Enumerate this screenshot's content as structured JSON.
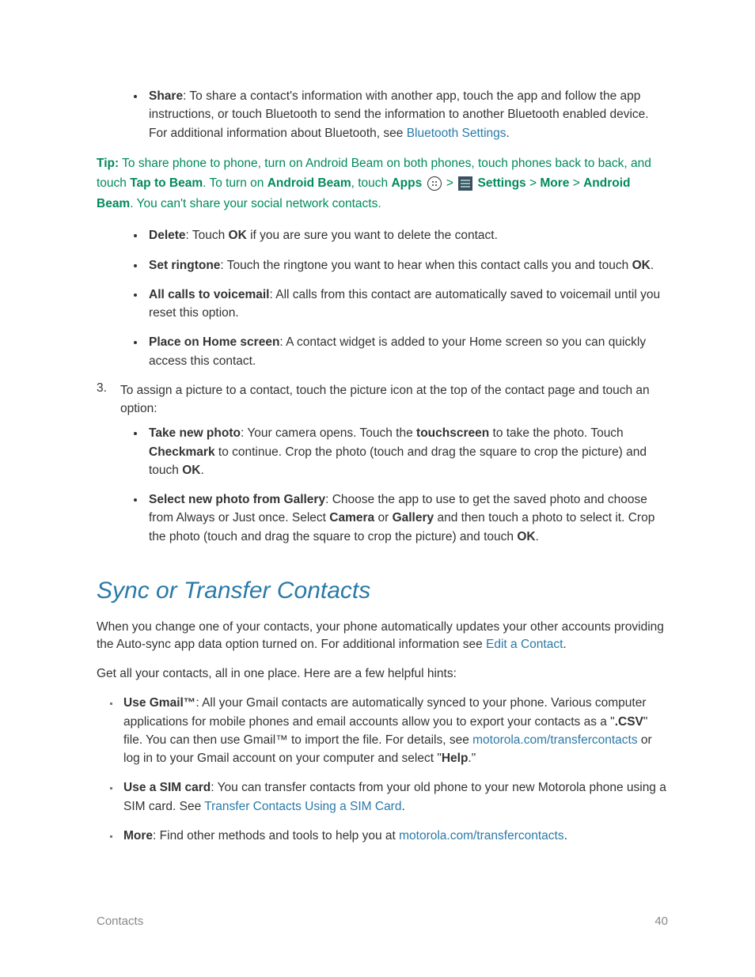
{
  "bullets1": {
    "share": {
      "label": "Share",
      "text": ": To share a contact's information with another app, touch the app and follow the app instructions, or touch Bluetooth to send the information to another Bluetooth enabled device. For additional information about Bluetooth, see ",
      "link": "Bluetooth Settings",
      "tail": "."
    }
  },
  "tip": {
    "label": "Tip:",
    "line1": " To share phone to phone, turn on Android Beam on both phones, touch phones back to back, and touch ",
    "tap_to_beam": "Tap to Beam",
    "seg2": ". To turn on ",
    "android_beam": "Android Beam",
    "seg3": ", touch ",
    "apps": "Apps",
    "gt1": " > ",
    "settings": "Settings",
    "gt2": " > ",
    "more": "More",
    "gt3": "  > ",
    "android_beam2": "Android Beam",
    "tail": ". You can't share your social network contacts."
  },
  "bullets2": {
    "delete": {
      "label": "Delete",
      "seg1": ": Touch ",
      "ok": "OK",
      "seg2": " if you are sure you want to delete the contact."
    },
    "ringtone": {
      "label": "Set ringtone",
      "seg1": ": Touch the ringtone you want to hear when this contact calls you and touch ",
      "ok": "OK",
      "tail": "."
    },
    "voicemail": {
      "label": "All calls to voicemail",
      "text": ": All calls from this contact are automatically saved to voicemail until you reset this option."
    },
    "home": {
      "label": "Place on Home screen",
      "text": ": A contact widget is added to your Home screen so you can quickly access this contact."
    }
  },
  "step3": {
    "num": "3.",
    "text": "To assign a picture to a contact, touch the picture icon at the top of the contact page and touch an option:"
  },
  "bullets3": {
    "take": {
      "label": "Take new photo",
      "seg1": ": Your camera opens. Touch the ",
      "touchscreen": "touchscreen",
      "seg2": " to take the photo. Touch ",
      "checkmark": "Checkmark",
      "seg3": " to continue. Crop the photo (touch and drag the square to crop the picture) and touch ",
      "ok": "OK",
      "tail": "."
    },
    "select": {
      "label": "Select new photo from Gallery",
      "seg1": ": Choose the app to use to get the saved photo and choose from Always or Just once. Select ",
      "camera": "Camera",
      "seg2": " or ",
      "gallery": "Gallery",
      "seg3": " and then touch a photo to select it. Crop the photo (touch and drag the square to crop the picture) and touch ",
      "ok": "OK",
      "tail": "."
    }
  },
  "section_heading": "Sync or Transfer Contacts",
  "para1": {
    "seg1": "When you change one of your contacts, your phone automatically updates your other accounts providing the Auto-sync app data option turned on. For additional information see ",
    "link": "Edit a Contact",
    "tail": "."
  },
  "para2": "Get all your contacts, all in one place. Here are a few helpful hints:",
  "bullets4": {
    "gmail": {
      "label": "Use Gmail™",
      "seg1": ": All your Gmail contacts are automatically synced to your phone. Various computer applications for mobile phones and email accounts allow you to export your contacts as a \"",
      "csv": ".CSV",
      "seg2": "\" file. You can then use Gmail™ to import the file. For details, see ",
      "link": "motorola.com/transfercontacts",
      "seg3": " or log in to your Gmail account on your computer and select \"",
      "help": "Help",
      "tail": ".\""
    },
    "sim": {
      "label": "Use a SIM card",
      "seg1": ": You can transfer contacts from your old phone to your new Motorola phone using a SIM card. See ",
      "link": "Transfer Contacts Using a SIM Card",
      "tail": "."
    },
    "more": {
      "label": "More",
      "seg1": ": Find other methods and tools to help you at ",
      "link": "motorola.com/transfercontacts",
      "tail": "."
    }
  },
  "footer": {
    "section": "Contacts",
    "page": "40"
  }
}
